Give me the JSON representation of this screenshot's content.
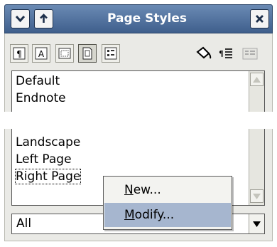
{
  "window": {
    "title": "Page Styles",
    "colors": {
      "titlebar": "#4c6a95",
      "menu_highlight": "#a6b6cf"
    }
  },
  "titlebar_buttons": [
    {
      "name": "collapse-down",
      "icon": "chevron-down-icon"
    },
    {
      "name": "move-up",
      "icon": "arrow-up-icon"
    },
    {
      "name": "close",
      "icon": "close-icon"
    }
  ],
  "toolbar": [
    {
      "name": "paragraph-styles",
      "icon": "paragraph-styles-icon",
      "active": false
    },
    {
      "name": "character-styles",
      "icon": "character-styles-icon",
      "active": false
    },
    {
      "name": "frame-styles",
      "icon": "frame-styles-icon",
      "active": false
    },
    {
      "name": "page-styles",
      "icon": "page-styles-icon",
      "active": true
    },
    {
      "name": "list-styles",
      "icon": "list-styles-icon",
      "active": false
    },
    {
      "name": "fill-format-mode",
      "icon": "paint-bucket-icon"
    },
    {
      "name": "new-style-from-selection",
      "icon": "new-style-icon"
    },
    {
      "name": "update-style",
      "icon": "update-style-icon"
    }
  ],
  "styles_list": {
    "items": [
      "Default",
      "Endnote",
      "Landscape",
      "Left Page",
      "Right Page"
    ],
    "selected": "Right Page"
  },
  "filter": {
    "value": "All"
  },
  "context_menu": {
    "items": [
      {
        "label_prefix": "",
        "accel": "N",
        "label_rest": "ew...",
        "highlighted": false
      },
      {
        "label_prefix": "",
        "accel": "M",
        "label_rest": "odify...",
        "highlighted": true
      }
    ]
  }
}
